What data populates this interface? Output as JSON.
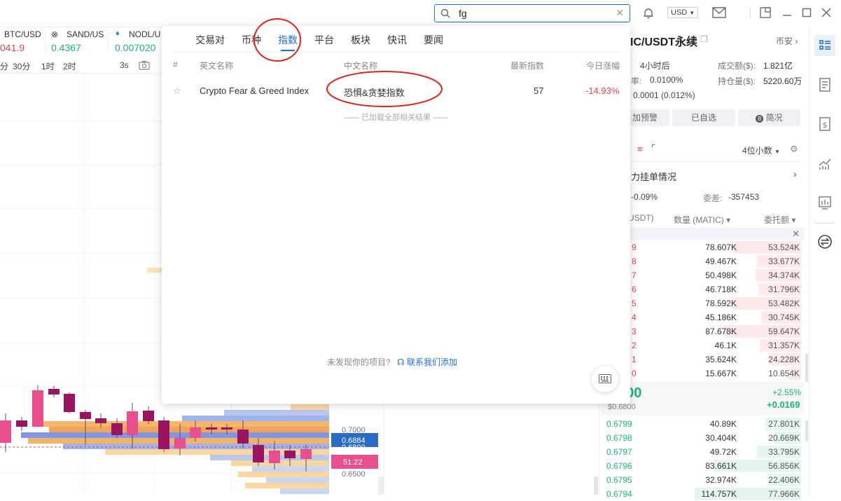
{
  "topbar": {
    "search_value": "fg",
    "currency": "USD"
  },
  "tickers": [
    {
      "name": "BTC/USD",
      "value": "041.9",
      "color": "red"
    },
    {
      "name": "SAND/US",
      "value": "0.4367",
      "color": "green"
    },
    {
      "name": "NODL/U",
      "value": "0.007020",
      "color": "green"
    }
  ],
  "timeframes": [
    "分",
    "30分",
    "1时",
    "2时"
  ],
  "chart_toolbar": {
    "interval": "3s"
  },
  "chart": {
    "price_labels": [
      "0.7000",
      "0.6884",
      "0.6800",
      "51:22",
      "0.6500"
    ]
  },
  "popup": {
    "tabs": [
      "交易对",
      "币种",
      "指数",
      "平台",
      "板块",
      "快讯",
      "要闻"
    ],
    "active_tab": "指数",
    "columns": {
      "num": "#",
      "en": "英文名称",
      "cn": "中文名称",
      "latest": "最新指数",
      "change": "今日涨幅"
    },
    "rows": [
      {
        "en": "Crypto Fear & Greed Index",
        "cn": "恐惧&贪婪指数",
        "latest": "57",
        "change": "-14.93%"
      }
    ],
    "loaded_note": "—— 已加载全部相关结果 ——",
    "footer_q": "未发现你的项目?",
    "footer_link": "联系我们添加"
  },
  "right": {
    "title": "IC/USDT永续",
    "exchange": "币安",
    "period": "4小时后",
    "volume_label": "成交额($):",
    "volume": "1.821亿",
    "rate_label": "率:",
    "rate": "0.0100%",
    "oi_label": "持仓量($):",
    "oi": "5220.60万",
    "change_small": "0.0001 (0.012%)",
    "btn_alert": "加预警",
    "btn_fav": "已自选",
    "btn_info": "简况",
    "decimals": "4位小数",
    "bigorder": "力挂单情况",
    "pct": "-0.09%",
    "diff_label": "委差:",
    "diff": "-357453",
    "col_price": "USDT)",
    "col_qty": "数量 (MATIC)",
    "col_total": "委托额",
    "asks": [
      {
        "p": "9",
        "q": "78.607K",
        "t": "53.524K",
        "w": 0.52
      },
      {
        "p": "8",
        "q": "49.467K",
        "t": "33.677K",
        "w": 0.33
      },
      {
        "p": "7",
        "q": "50.498K",
        "t": "34.374K",
        "w": 0.34
      },
      {
        "p": "6",
        "q": "46.718K",
        "t": "31.796K",
        "w": 0.32
      },
      {
        "p": "5",
        "q": "78.592K",
        "t": "53.482K",
        "w": 0.52
      },
      {
        "p": "4",
        "q": "45.186K",
        "t": "30.745K",
        "w": 0.3
      },
      {
        "p": "3",
        "q": "87.678K",
        "t": "59.647K",
        "w": 0.58
      },
      {
        "p": "2",
        "q": "46.1K",
        "t": "31.357K",
        "w": 0.31
      },
      {
        "p": "1",
        "q": "35.624K",
        "t": "24.228K",
        "w": 0.24
      },
      {
        "p": "0",
        "q": "15.667K",
        "t": "10.654K",
        "w": 0.1
      }
    ],
    "last_price": "800",
    "last_sub": "$0.6800",
    "change_pct": "+2.55%",
    "change_abs": "+0.0169",
    "bids": [
      {
        "p": "0.6799",
        "q": "40.89K",
        "t": "27.801K",
        "w": 0.27
      },
      {
        "p": "0.6798",
        "q": "30.404K",
        "t": "20.669K",
        "w": 0.2
      },
      {
        "p": "0.6797",
        "q": "49.72K",
        "t": "33.795K",
        "w": 0.33
      },
      {
        "p": "0.6796",
        "q": "83.661K",
        "t": "56.856K",
        "w": 0.66
      },
      {
        "p": "0.6795",
        "q": "32.974K",
        "t": "22.406K",
        "w": 0.25
      },
      {
        "p": "0.6794",
        "q": "114.757K",
        "t": "77.966K",
        "w": 0.8
      }
    ]
  },
  "colors": {
    "accent": "#1f6fd8",
    "red": "#e0474d",
    "green": "#1db17c",
    "annotation": "#e0231b"
  }
}
